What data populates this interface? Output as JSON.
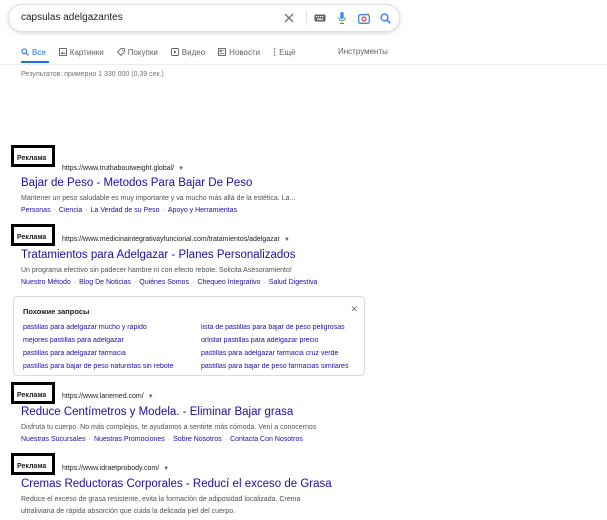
{
  "search": {
    "query": "capsulas adelgazantes",
    "icons": [
      "close-icon",
      "keyboard-icon",
      "microphone-icon",
      "camera-icon",
      "search-icon"
    ]
  },
  "tabs": [
    {
      "label": "Все",
      "icon": "search-icon",
      "active": true
    },
    {
      "label": "Картинки",
      "icon": "image-icon"
    },
    {
      "label": "Покупки",
      "icon": "tag-icon"
    },
    {
      "label": "Видео",
      "icon": "play-icon"
    },
    {
      "label": "Новости",
      "icon": "news-icon"
    },
    {
      "label": "Ещё",
      "icon": "more-vert-icon"
    }
  ],
  "tools_label": "Инструменты",
  "stats": "Результатов: примерно 1 330 000 (0,39 сек.)",
  "ad_label": "Реклама",
  "ads": [
    {
      "url": "https://www.truthaboutweight.global/",
      "title": "Bajar de Peso - Metodos Para Bajar De Peso",
      "desc": "Mantener un peso saludable es muy importante y va mucho más allá de la estética. La...",
      "sitelinks": [
        "Personas",
        "Ciencia",
        "La Verdad de su Peso",
        "Apoyo y Herramientas"
      ]
    },
    {
      "url": "https://www.medicinaintegrativayfuncional.com/tratamientos/adelgazar",
      "title": "Tratamientos para Adelgazar - Planes Personalizados",
      "desc": "Un programa efectivo sin padecer hambre ni con efecto rebote. Solicita Asesoramiento!",
      "sitelinks": [
        "Nuestro Método",
        "Blog De Noticias",
        "Quiénes Somos",
        "Chequeo Integrativo",
        "Salud Digestiva"
      ]
    },
    {
      "url": "https://www.lanemed.com/",
      "title": "Reduce Centímetros y Modela. - Eliminar Bajar grasa",
      "desc": "Disfruta tu cuerpo. No más complejos, te ayudamos a sentirte más cómoda. Vení a conocernos",
      "sitelinks": [
        "Nuestras Sucursales",
        "Nuestras Promociones",
        "Sobre Nosotros",
        "Contacta Con Nosotros"
      ]
    },
    {
      "url": "https://www.idraetprobody.com/",
      "title": "Cremas Reductoras Corporales - Reducí el exceso de Grasa",
      "desc": "Reduce el exceso de grasa resistente, evita la formación de adiposidad localizada. Crema",
      "desc2": "ultraliviana de rápida absorción que cuida la delicada piel del cuerpo."
    }
  ],
  "related": {
    "title": "Похожие запросы",
    "left": [
      "pastillas para adelgazar mucho y rápido",
      "mejores pastillas para adelgazar",
      "pastillas para adelgazar farmacia",
      "pastillas para bajar de peso naturistas sin rebote"
    ],
    "right": [
      "lista de pastillas para bajar de peso peligrosas",
      "orlistat pastillas para adelgazar precio",
      "pastillas para adelgazar farmacia cruz verde",
      "pastillas para bajar de peso farmacias similares"
    ]
  }
}
